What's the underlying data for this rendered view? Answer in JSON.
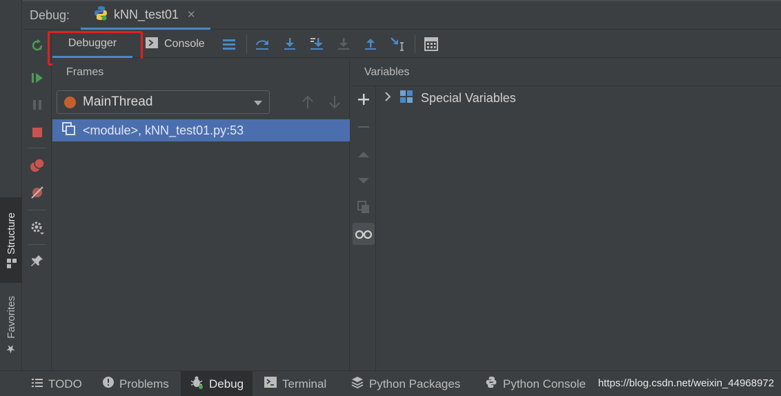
{
  "header": {
    "debug_label": "Debug:",
    "run_tab": "kNN_test01"
  },
  "tabs": {
    "debugger": "Debugger",
    "console": "Console"
  },
  "frames": {
    "title": "Frames",
    "thread": "MainThread",
    "frame_item": "<module>, kNN_test01.py:53"
  },
  "variables": {
    "title": "Variables",
    "special": "Special Variables"
  },
  "left_stripe": {
    "structure": "Structure",
    "favorites": "Favorites"
  },
  "bottom_bar": {
    "todo": "TODO",
    "problems": "Problems",
    "debug": "Debug",
    "terminal": "Terminal",
    "python_packages": "Python Packages",
    "python_console": "Python Console",
    "watermark": "https://blog.csdn.net/weixin_44968972"
  },
  "colors": {
    "background": "#3c3f41",
    "selection": "#4b6eaf",
    "accent": "#4a88c7",
    "highlight_box": "#e02020",
    "resume_green": "#499c54",
    "stop_red": "#c75450"
  }
}
